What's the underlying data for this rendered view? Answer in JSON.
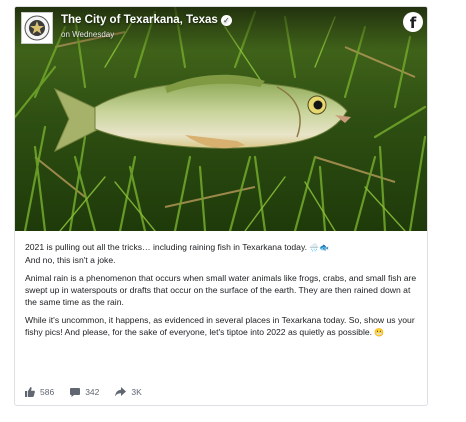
{
  "post": {
    "page_name": "The City of Texarkana, Texas",
    "timestamp": "on Wednesday",
    "paragraphs": [
      {
        "text": "2021 is pulling out all the tricks… including raining fish in Texarkana today.",
        "emoji": "🌧️🐟",
        "second_line": "And no, this isn't a joke."
      },
      {
        "text": "Animal rain is a phenomenon that occurs when small water animals like frogs, crabs, and small fish are swept up in waterspouts or drafts that occur on the surface of the earth. They are then rained down at the same time as the rain."
      },
      {
        "text": "While it's uncommon, it happens, as evidenced in several places in Texarkana today. So, show us your fishy pics! And please, for the sake of everyone, let's tiptoe into 2022 as quietly as possible.",
        "emoji": "😬"
      }
    ]
  },
  "reactions": {
    "likes": "586",
    "comments": "342",
    "shares": "3K"
  },
  "icons": {
    "brand": "facebook-icon",
    "verified": "verified-badge-icon",
    "like": "thumbs-up-icon",
    "comment": "comment-icon",
    "share": "share-icon"
  },
  "colors": {
    "text": "#1c1e21",
    "muted": "#606770",
    "grass": "#3d6b1c"
  }
}
